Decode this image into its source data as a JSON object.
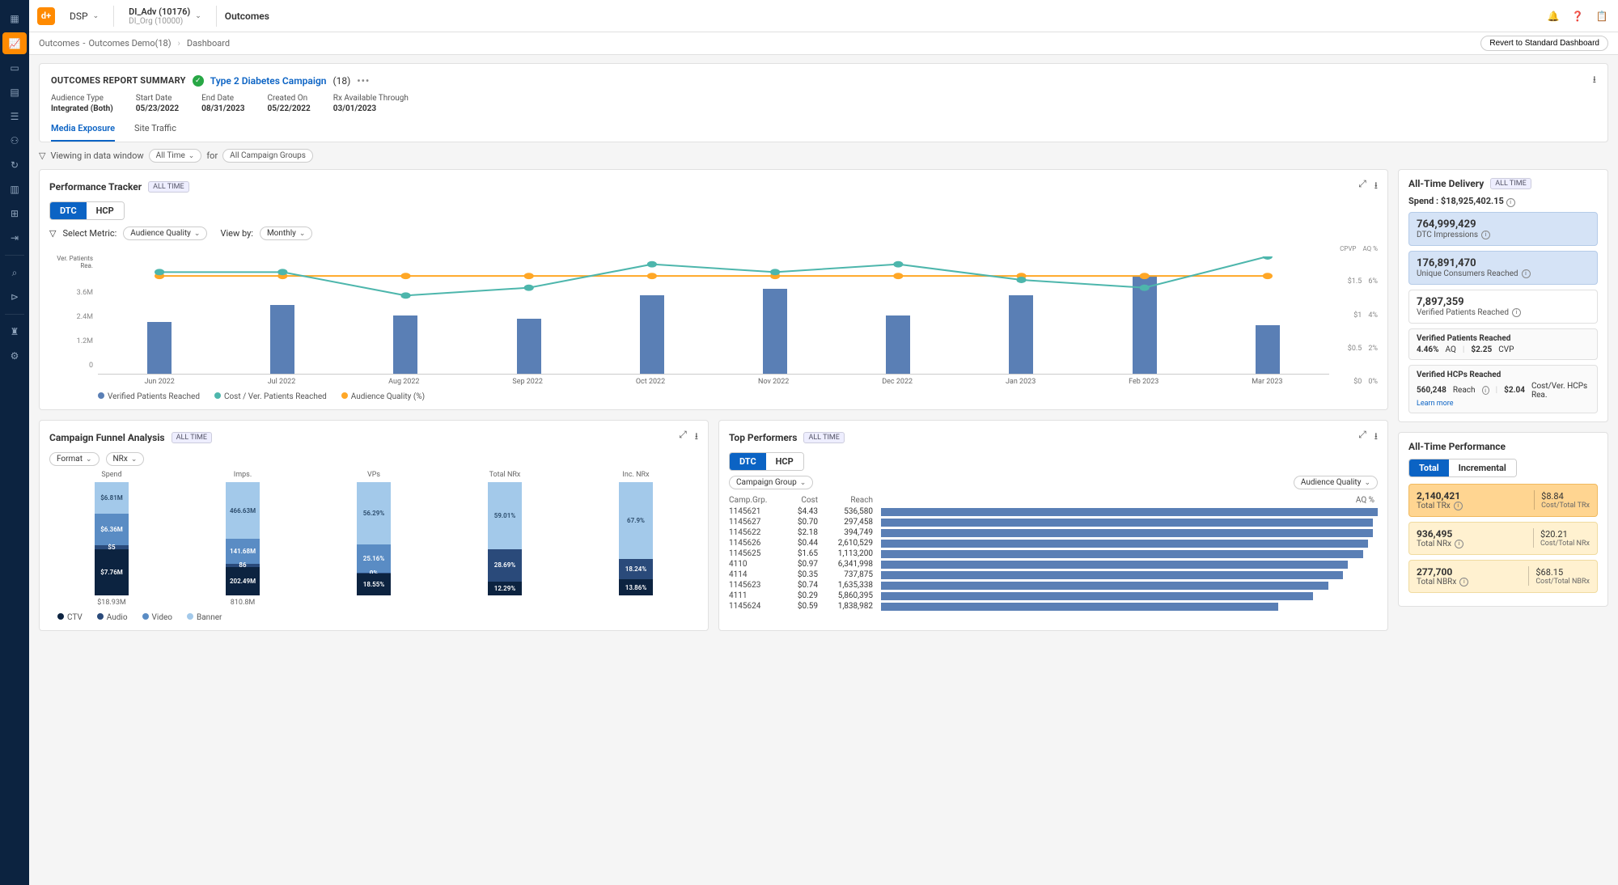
{
  "topbar": {
    "logo": "d+",
    "account_label": "DSP",
    "adv_line1": "DI_Adv (10176)",
    "adv_line2": "DI_Org (10000)",
    "page_title": "Outcomes"
  },
  "breadcrumb": {
    "c1": "Outcomes",
    "c2": "Outcomes Demo(18)",
    "c3": "Dashboard",
    "revert": "Revert to Standard Dashboard"
  },
  "summary": {
    "title": "OUTCOMES REPORT SUMMARY",
    "campaign": "Type 2 Diabetes Campaign",
    "campaign_id": "(18)",
    "fields": [
      {
        "lbl": "Audience Type",
        "val": "Integrated (Both)"
      },
      {
        "lbl": "Start Date",
        "val": "05/23/2022"
      },
      {
        "lbl": "End Date",
        "val": "08/31/2023"
      },
      {
        "lbl": "Created On",
        "val": "05/22/2022"
      },
      {
        "lbl": "Rx Available Through",
        "val": "03/01/2023"
      }
    ],
    "tabs": [
      "Media Exposure",
      "Site Traffic"
    ]
  },
  "filterbar": {
    "viewing": "Viewing in data window",
    "all_time": "All Time",
    "for": "for",
    "all_groups": "All Campaign Groups"
  },
  "perf_tracker": {
    "title": "Performance Tracker",
    "badge": "ALL TIME",
    "toggle": [
      "DTC",
      "HCP"
    ],
    "select_metric_lbl": "Select Metric:",
    "select_metric": "Audience Quality",
    "view_by_lbl": "View by:",
    "view_by": "Monthly",
    "y_title": "Ver. Patients Rea.",
    "y_ticks": [
      "3.6M",
      "2.4M",
      "1.2M",
      "0"
    ],
    "y2_cpvp": "CPVP",
    "y2_aq": "AQ %",
    "y2_ticks": [
      [
        "$1.5",
        "6%"
      ],
      [
        "$1",
        "4%"
      ],
      [
        "$0.5",
        "2%"
      ],
      [
        "$0",
        "0%"
      ]
    ],
    "legend": [
      "Verified Patients Reached",
      "Cost / Ver. Patients Reached",
      "Audience Quality (%)"
    ]
  },
  "funnel": {
    "title": "Campaign Funnel Analysis",
    "badge": "ALL TIME",
    "dd1": "Format",
    "dd2": "NRx",
    "cols": [
      "Spend",
      "Imps.",
      "VPs",
      "Total NRx",
      "Inc. NRx"
    ],
    "totals": [
      "$18.93M",
      "810.8M",
      "",
      "",
      ""
    ],
    "legend": [
      "CTV",
      "Audio",
      "Video",
      "Banner"
    ]
  },
  "top_perf": {
    "title": "Top Performers",
    "badge": "ALL TIME",
    "toggle": [
      "DTC",
      "HCP"
    ],
    "dd": "Campaign Group",
    "dd2": "Audience Quality",
    "headers": [
      "Camp.Grp.",
      "Cost",
      "Reach",
      "AQ %"
    ]
  },
  "delivery": {
    "title": "All-Time Delivery",
    "badge": "ALL TIME",
    "spend_lbl": "Spend : ",
    "spend_val": "$18,925,402.15",
    "cards": [
      {
        "big": "764,999,429",
        "sub": "DTC Impressions"
      },
      {
        "big": "176,891,470",
        "sub": "Unique Consumers Reached"
      },
      {
        "big": "7,897,359",
        "sub": "Verified Patients Reached"
      }
    ],
    "vpr": {
      "hdr": "Verified Patients Reached",
      "aq": "4.46%",
      "aq_lbl": "AQ",
      "cvp": "$2.25",
      "cvp_lbl": "CVP"
    },
    "vhr": {
      "hdr": "Verified HCPs Reached",
      "reach": "560,248",
      "reach_lbl": "Reach",
      "cost": "$2.04",
      "cost_lbl": "Cost/Ver. HCPs Rea.",
      "learn": "Learn more"
    }
  },
  "performance": {
    "title": "All-Time Performance",
    "toggle": [
      "Total",
      "Incremental"
    ],
    "cards": [
      {
        "big": "2,140,421",
        "sub": "Total TRx",
        "r1": "$8.84",
        "r2": "Cost/Total TRx",
        "cls": "orange"
      },
      {
        "big": "936,495",
        "sub": "Total NRx",
        "r1": "$20.21",
        "r2": "Cost/Total NRx",
        "cls": "yellow"
      },
      {
        "big": "277,700",
        "sub": "Total NBRx",
        "r1": "$68.15",
        "r2": "Cost/Total NBRx",
        "cls": "yellow"
      }
    ]
  },
  "chart_data": [
    {
      "type": "bar+line",
      "name": "performance_tracker",
      "categories": [
        "Jun 2022",
        "Jul 2022",
        "Aug 2022",
        "Sep 2022",
        "Oct 2022",
        "Nov 2022",
        "Dec 2022",
        "Jan 2023",
        "Feb 2023",
        "Mar 2023"
      ],
      "series": [
        {
          "name": "Verified Patients Reached",
          "type": "bar",
          "values": [
            1.6,
            2.1,
            1.8,
            1.7,
            2.4,
            2.6,
            1.8,
            2.4,
            3.0,
            1.5
          ],
          "unit": "M"
        },
        {
          "name": "Cost / Ver. Patients Reached",
          "type": "line",
          "values": [
            1.3,
            1.3,
            1.0,
            1.1,
            1.4,
            1.3,
            1.4,
            1.2,
            1.1,
            1.5
          ],
          "unit": "$"
        },
        {
          "name": "Audience Quality (%)",
          "type": "line",
          "values": [
            5.0,
            5.0,
            5.0,
            5.0,
            5.0,
            5.0,
            5.0,
            5.0,
            5.0,
            5.0
          ],
          "unit": "%"
        }
      ],
      "ylabel": "Ver. Patients Reached (M)",
      "ylim": [
        0,
        3.6
      ],
      "y2labels": [
        "CPVP ($)",
        "AQ %"
      ],
      "y2lims": [
        [
          0,
          1.5
        ],
        [
          0,
          6
        ]
      ]
    },
    {
      "type": "stacked_bar",
      "name": "campaign_funnel",
      "categories": [
        "Spend",
        "Imps.",
        "VPs",
        "Total NRx",
        "Inc. NRx"
      ],
      "stack_names": [
        "CTV",
        "Audio",
        "Video",
        "Banner"
      ],
      "display_labels": [
        [
          "$7.76M",
          "$5",
          "$6.36M",
          "$6.81M"
        ],
        [
          "202.49M",
          "86",
          "141.68M",
          "466.63M"
        ],
        [
          "18.55%",
          "0%",
          "25.16%",
          "56.29%"
        ],
        [
          "12.29%",
          "28.69%",
          "",
          "59.01%"
        ],
        [
          "13.86%",
          "18.24%",
          "",
          "67.9%"
        ]
      ],
      "totals": [
        "$18.93M",
        "810.8M",
        "",
        "",
        ""
      ]
    },
    {
      "type": "bar",
      "name": "top_performers",
      "orientation": "horizontal",
      "xlabel": "AQ %",
      "rows": [
        {
          "grp": "1145621",
          "cost": "$4.43",
          "reach": "536,580",
          "aq_rel": 100
        },
        {
          "grp": "1145627",
          "cost": "$0.70",
          "reach": "297,458",
          "aq_rel": 99
        },
        {
          "grp": "1145622",
          "cost": "$2.18",
          "reach": "394,749",
          "aq_rel": 99
        },
        {
          "grp": "1145626",
          "cost": "$0.44",
          "reach": "2,610,529",
          "aq_rel": 98
        },
        {
          "grp": "1145625",
          "cost": "$1.65",
          "reach": "1,113,200",
          "aq_rel": 97
        },
        {
          "grp": "4110",
          "cost": "$0.97",
          "reach": "6,341,998",
          "aq_rel": 94
        },
        {
          "grp": "4114",
          "cost": "$0.35",
          "reach": "737,875",
          "aq_rel": 93
        },
        {
          "grp": "1145623",
          "cost": "$0.74",
          "reach": "1,635,338",
          "aq_rel": 90
        },
        {
          "grp": "4111",
          "cost": "$0.29",
          "reach": "5,860,395",
          "aq_rel": 87
        },
        {
          "grp": "1145624",
          "cost": "$0.59",
          "reach": "1,838,982",
          "aq_rel": 80
        }
      ]
    }
  ]
}
